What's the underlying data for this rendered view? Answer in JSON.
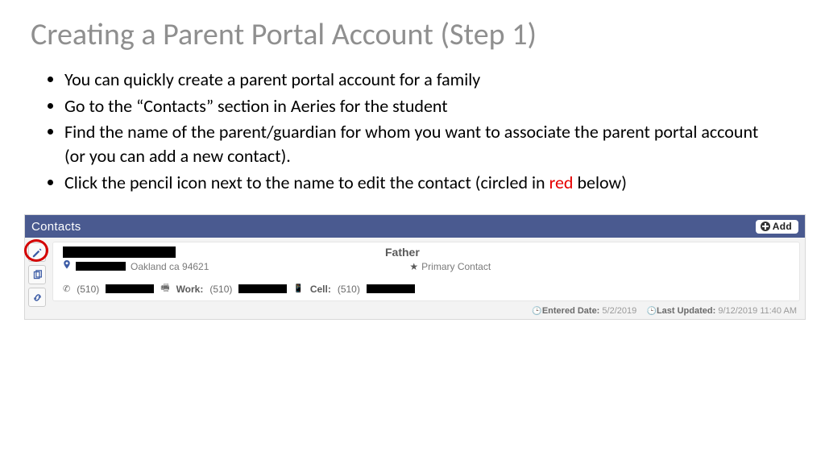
{
  "title": "Creating a Parent Portal Account (Step 1)",
  "bullets": [
    "You can quickly create a parent portal account for a family",
    "Go to the “Contacts” section in Aeries for the student",
    "Find the name of the parent/guardian for whom you want to associate the parent portal account (or you can add a new contact).",
    "Click the pencil icon next to the name to edit the contact (circled in <span class=\"red\">red</span> below)"
  ],
  "panel": {
    "header": "Contacts",
    "add_label": "Add"
  },
  "contact": {
    "relation": "Father",
    "city_state_zip": "Oakland ca 94621",
    "primary_label": "Primary Contact",
    "area_code": "(510)",
    "work_label": "Work:",
    "cell_label": "Cell:",
    "entered_label": "Entered Date:",
    "entered_value": "5/2/2019",
    "updated_label": "Last Updated:",
    "updated_value": "9/12/2019 11:40 AM"
  }
}
